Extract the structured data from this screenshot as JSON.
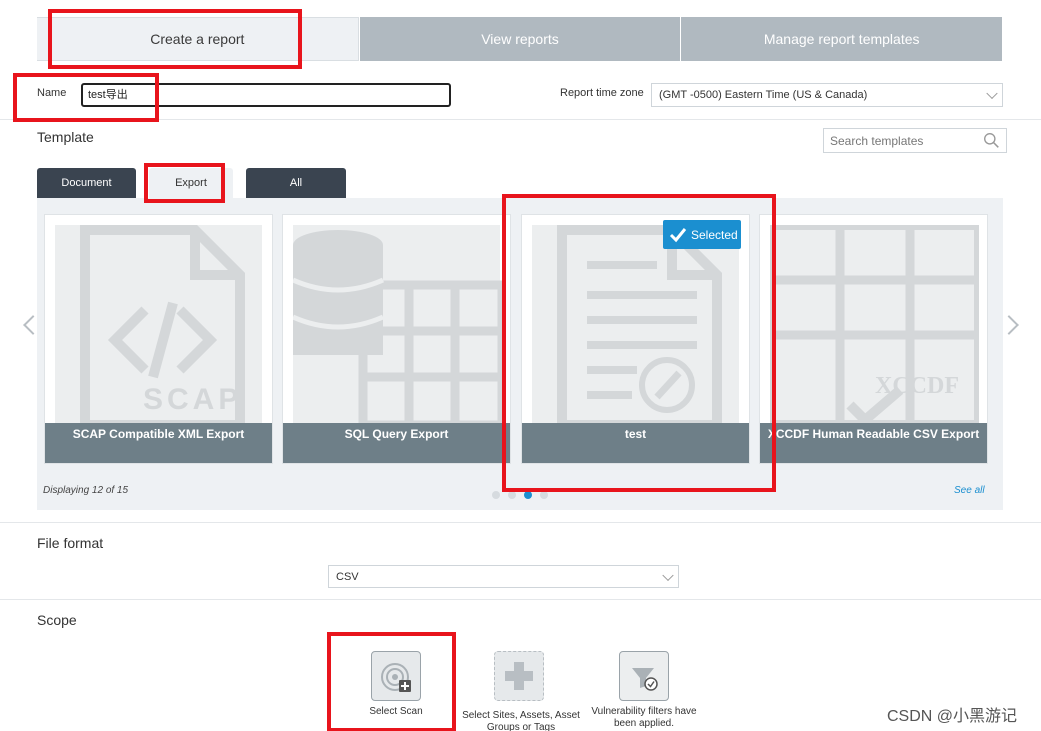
{
  "tabs": [
    "Create a report",
    "View reports",
    "Manage report templates"
  ],
  "name": {
    "label": "Name",
    "value": "test导出"
  },
  "timezone": {
    "label": "Report time zone",
    "value": "(GMT -0500) Eastern Time (US & Canada)"
  },
  "template": {
    "title": "Template",
    "search_placeholder": "Search templates",
    "filters": [
      "Document",
      "Export",
      "All"
    ],
    "cards": [
      {
        "caption": "SCAP Compatible XML Export",
        "art_text": "SCAP"
      },
      {
        "caption": "SQL Query Export"
      },
      {
        "caption": "test"
      },
      {
        "caption": "XCCDF Human Readable CSV Export",
        "art_text": "XCCDF"
      }
    ],
    "selected_label": "Selected",
    "displaying": "Displaying 12 of 15",
    "see_all": "See all",
    "pager": {
      "pages": 4,
      "current": 3
    }
  },
  "file_format": {
    "title": "File format",
    "value": "CSV"
  },
  "scope": {
    "title": "Scope",
    "items": [
      {
        "label": "Select Scan"
      },
      {
        "label": "Select Sites, Assets, Asset Groups or Tags"
      },
      {
        "label": "Vulnerability filters have been applied."
      }
    ]
  },
  "watermark": "CSDN @小黑游记",
  "colors": {
    "accent": "#1b8fd0",
    "highlight": "#e8141c",
    "tab_inactive": "#b0b9c0",
    "dark_tab": "#3a4450",
    "caption_bg": "#6e7f88"
  }
}
